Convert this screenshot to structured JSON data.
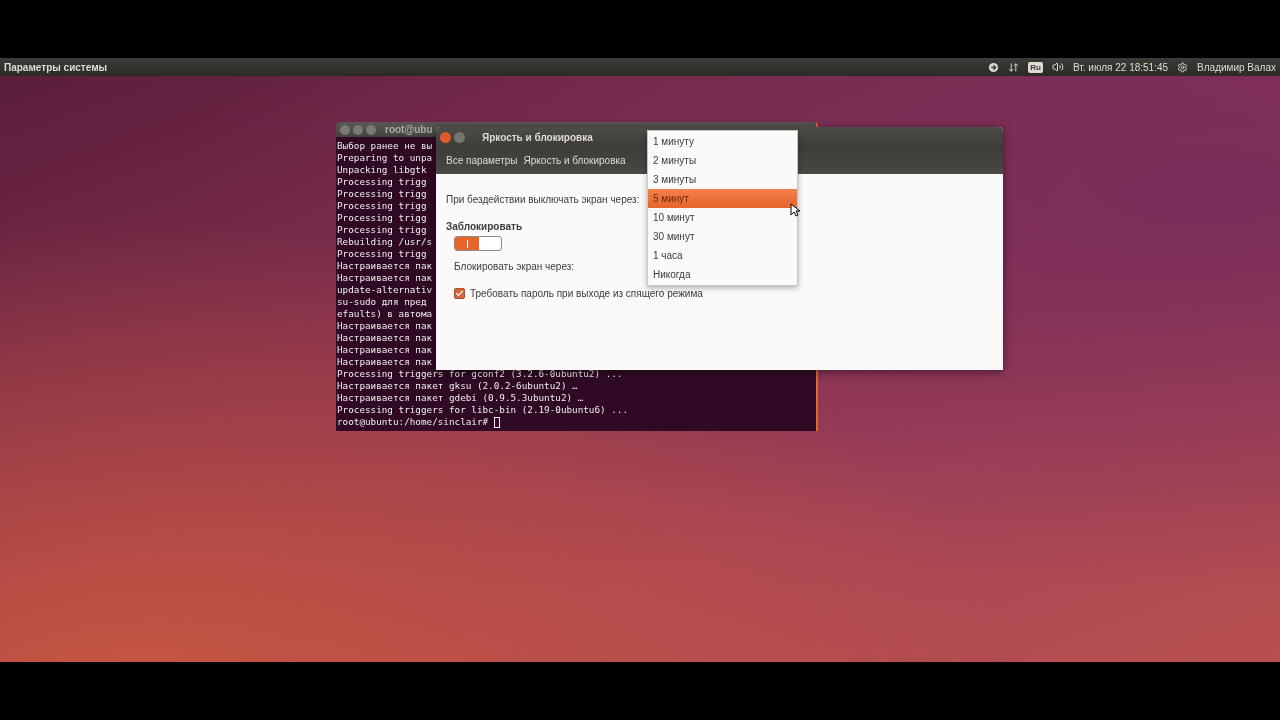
{
  "top_panel": {
    "app_title": "Параметры системы",
    "keyboard_layout": "Ru",
    "clock": "Вт. июля 22 18:51:45",
    "user": "Владимир Валах"
  },
  "terminal": {
    "title": "root@ubu",
    "lines": [
      "Выбор ранее не вы",
      "Preparing to unpa",
      "Unpacking libgtk",
      "Processing trigg",
      "Processing trigg",
      "Processing trigg",
      "Processing trigg",
      "Processing trigg",
      "Rebuilding /usr/s",
      "Processing trigg",
      "Настраивается пак",
      "Настраивается пак",
      "update-alternativ",
      "su-sudo для пред",
      "efaults) в автома",
      "Настраивается пак",
      "Настраивается пак",
      "Настраивается пак",
      "Настраивается пак",
      "Processing triggers for gconf2 (3.2.6-0ubuntu2) ...",
      "Настраивается пакет gksu (2.0.2-6ubuntu2) …",
      "Настраивается пакет gdebi (0.9.5.3ubuntu2) …",
      "Processing triggers for libc-bin (2.19-0ubuntu6) ..."
    ],
    "prompt": "root@ubuntu:/home/sinclair#"
  },
  "settings_window": {
    "title": "Яркость и блокировка",
    "breadcrumbs": [
      "Все параметры",
      "Яркость и блокировка"
    ],
    "idle_label": "При бездействии выключать экран через:",
    "lock_heading": "Заблокировать",
    "lock_switch": {
      "on": true
    },
    "lock_after_label": "Блокировать экран через:",
    "require_password": {
      "label": "Требовать пароль при выходе из спящего режима",
      "checked": true
    }
  },
  "dropdown": {
    "options": [
      {
        "label": "1 минуту",
        "selected": false
      },
      {
        "label": "2 минуты",
        "selected": false
      },
      {
        "label": "3 минуты",
        "selected": false
      },
      {
        "label": "5 минут",
        "selected": true
      },
      {
        "label": "10 минут",
        "selected": false
      },
      {
        "label": "30 минут",
        "selected": false
      },
      {
        "label": "1 часа",
        "selected": false
      },
      {
        "label": "Никогда",
        "selected": false
      }
    ]
  }
}
